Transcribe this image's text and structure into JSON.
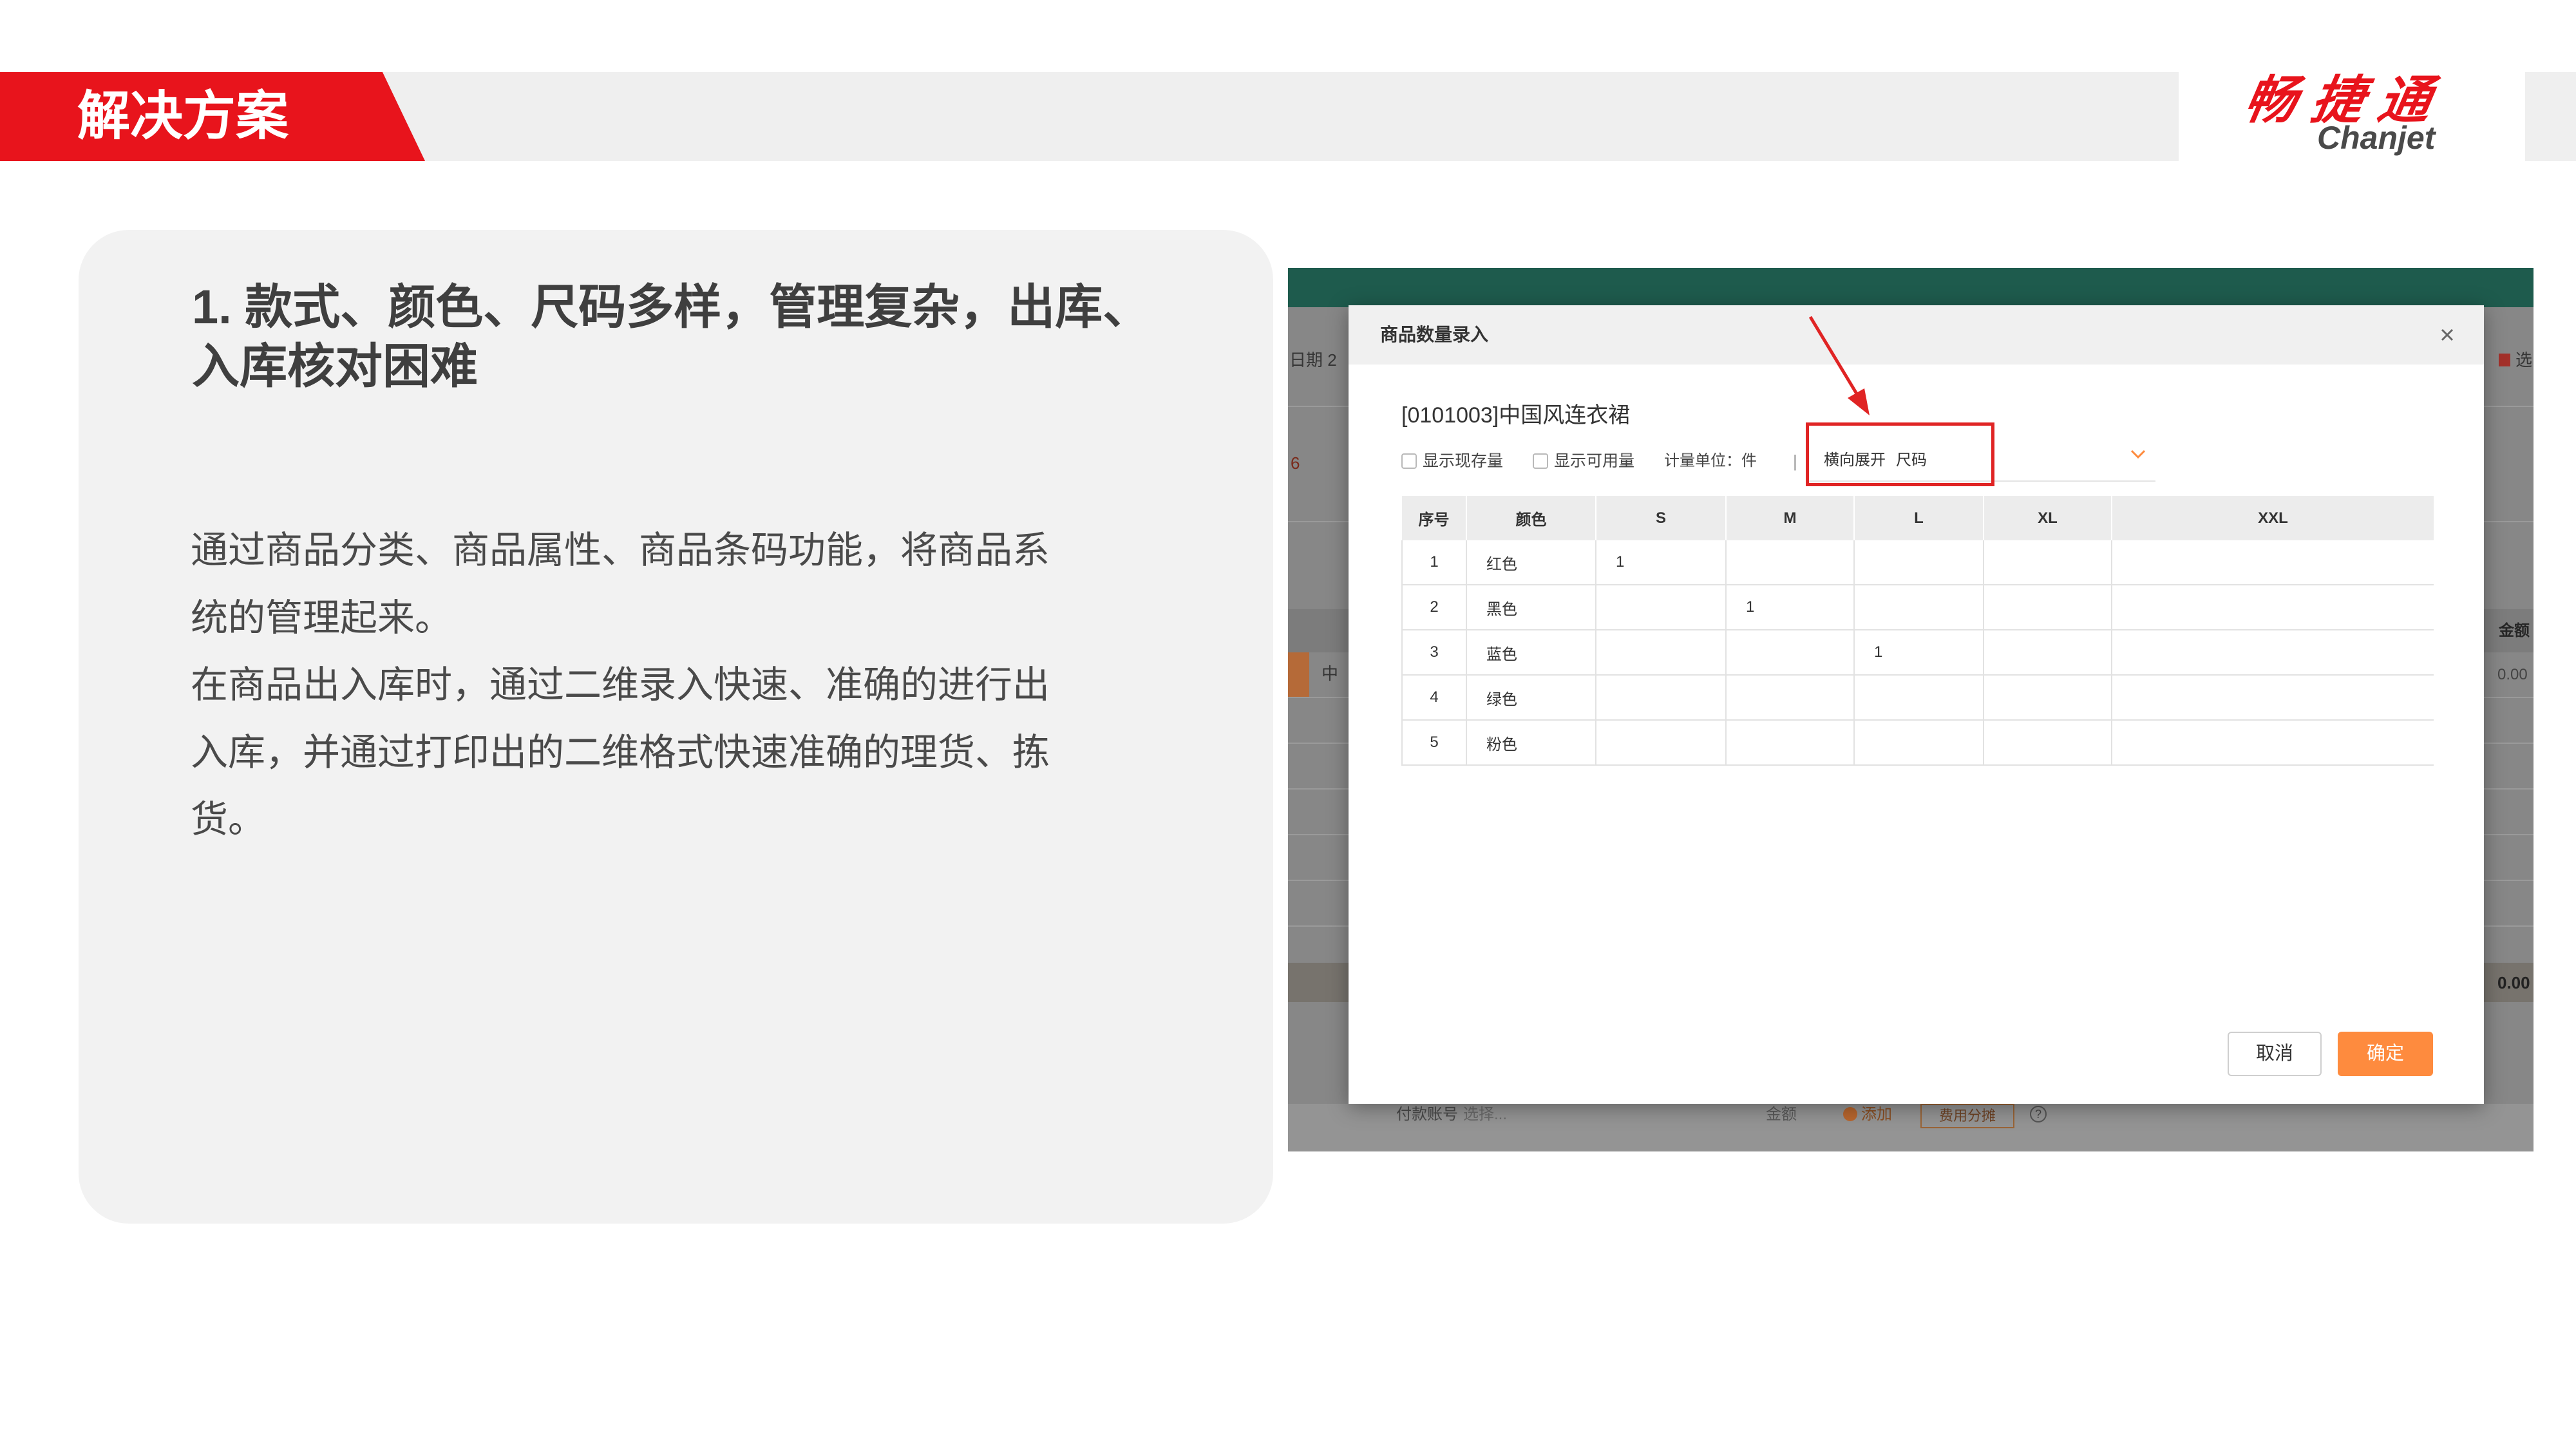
{
  "header": {
    "section_title": "解决方案"
  },
  "logo": {
    "name_cn": "畅捷通",
    "name_en": "Chanjet"
  },
  "card": {
    "title_lines": [
      "1. 款式、颜色、尺码多样，管理复杂，出库、",
      "入库核对困难"
    ],
    "body_lines": [
      "通过商品分类、商品属性、商品条码功能，将商品系",
      "统的管理起来。",
      "在商品出入库时，通过二维录入快速、准确的进行出",
      "入库，并通过打印出的二维格式快速准确的理货、拣",
      "货。"
    ]
  },
  "screenshot": {
    "background_app": {
      "date_label": "日期 2",
      "flag_digit": "6",
      "row_cell": "中",
      "top_right_label": "选",
      "amount_header": "金额",
      "amount_value": "0.00",
      "total_amount": "0.00",
      "payment_account_label": "付款账号",
      "payment_account_placeholder": "选择...",
      "amount_label": "金额",
      "add_label": "添加",
      "fee_split_label": "费用分摊",
      "help_glyph": "?"
    },
    "dialog": {
      "title": "商品数量录入",
      "product": "[0101003]中国风连衣裙",
      "show_stock": {
        "label": "显示现存量",
        "checked": false
      },
      "show_available": {
        "label": "显示可用量",
        "checked": false
      },
      "unit": "计量单位：件",
      "separator": "|",
      "expand": {
        "mode": "横向展开",
        "value": "尺码"
      },
      "table": {
        "columns": [
          "序号",
          "颜色",
          "S",
          "M",
          "L",
          "XL",
          "XXL"
        ],
        "rows": [
          [
            "1",
            "红色",
            "1",
            "",
            "",
            "",
            ""
          ],
          [
            "2",
            "黑色",
            "",
            "1",
            "",
            "",
            ""
          ],
          [
            "3",
            "蓝色",
            "",
            "",
            "1",
            "",
            ""
          ],
          [
            "4",
            "绿色",
            "",
            "",
            "",
            "",
            ""
          ],
          [
            "5",
            "粉色",
            "",
            "",
            "",
            "",
            ""
          ]
        ]
      },
      "cancel_label": "取消",
      "confirm_label": "确定"
    }
  },
  "icons": {
    "close": "close-icon",
    "dropdown": "chevron-down-icon",
    "checkbox": "checkbox-icon",
    "add": "plus-circle-icon",
    "help": "help-circle-icon",
    "annotation": "arrow-icon"
  },
  "colors": {
    "brand_red": "#e8141c",
    "confirm_orange": "#fe8b3e",
    "annotation_red": "#e02424",
    "app_teal": "#1e5b4d"
  }
}
